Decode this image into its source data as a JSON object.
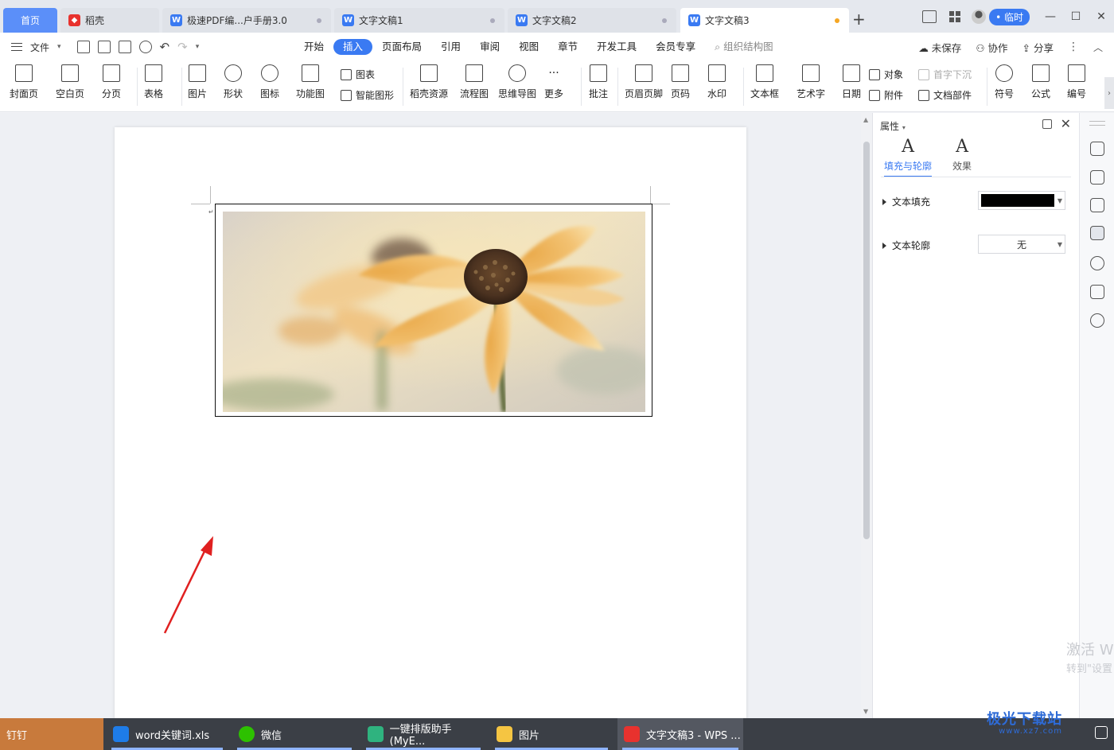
{
  "tabs": [
    {
      "label": "首页",
      "type": "home"
    },
    {
      "label": "稻壳",
      "type": "shell"
    },
    {
      "label": "极速PDF编...户手册3.0",
      "type": "doc"
    },
    {
      "label": "文字文稿1",
      "type": "doc"
    },
    {
      "label": "文字文稿2",
      "type": "doc"
    },
    {
      "label": "文字文稿3",
      "type": "doc",
      "active": true,
      "modified": true
    }
  ],
  "titlebar": {
    "new_tab": "+",
    "user_badge": "• 临时",
    "minimize": "—",
    "maximize": "☐",
    "close": "✕"
  },
  "menu": {
    "file": "文件",
    "tabs": [
      "开始",
      "插入",
      "页面布局",
      "引用",
      "审阅",
      "视图",
      "章节",
      "开发工具",
      "会员专享"
    ],
    "active_tab": "插入",
    "search": "组织结构图",
    "unsaved": "未保存",
    "collaborate": "协作",
    "share": "分享"
  },
  "ribbon": {
    "cover_page": "封面页",
    "blank_page": "空白页",
    "page_break": "分页",
    "table": "表格",
    "picture": "图片",
    "shape": "形状",
    "icon": "图标",
    "function_chart": "功能图",
    "chart": "图表",
    "smart_art": "智能图形",
    "docer_resource": "稻壳资源",
    "flowchart": "流程图",
    "mindmap": "思维导图",
    "more": "更多",
    "comment": "批注",
    "header_footer": "页眉页脚",
    "page_number": "页码",
    "watermark": "水印",
    "textbox": "文本框",
    "wordart": "艺术字",
    "date": "日期",
    "object": "对象",
    "attachment": "附件",
    "drop_cap": "首字下沉",
    "doc_parts": "文档部件",
    "symbol": "符号",
    "formula": "公式",
    "numbering": "编号"
  },
  "properties": {
    "header": "属性",
    "tab_fill": "填充与轮廓",
    "tab_effect": "效果",
    "text_fill_label": "文本填充",
    "text_fill_color": "#000000",
    "text_outline_label": "文本轮廓",
    "text_outline_value": "无"
  },
  "watermark": {
    "line1": "激活 W",
    "line2": "转到\"设置"
  },
  "taskbar": {
    "items": [
      "钉钉",
      "word关键词.xls",
      "微信",
      "一键排版助手(MyE...",
      "图片",
      "文字文稿3 - WPS ..."
    ],
    "brand": "极光下载站",
    "brand_url": "www.xz7.com"
  },
  "colors": {
    "accent": "#3a7af2",
    "annotation_arrow": "#e02020"
  }
}
